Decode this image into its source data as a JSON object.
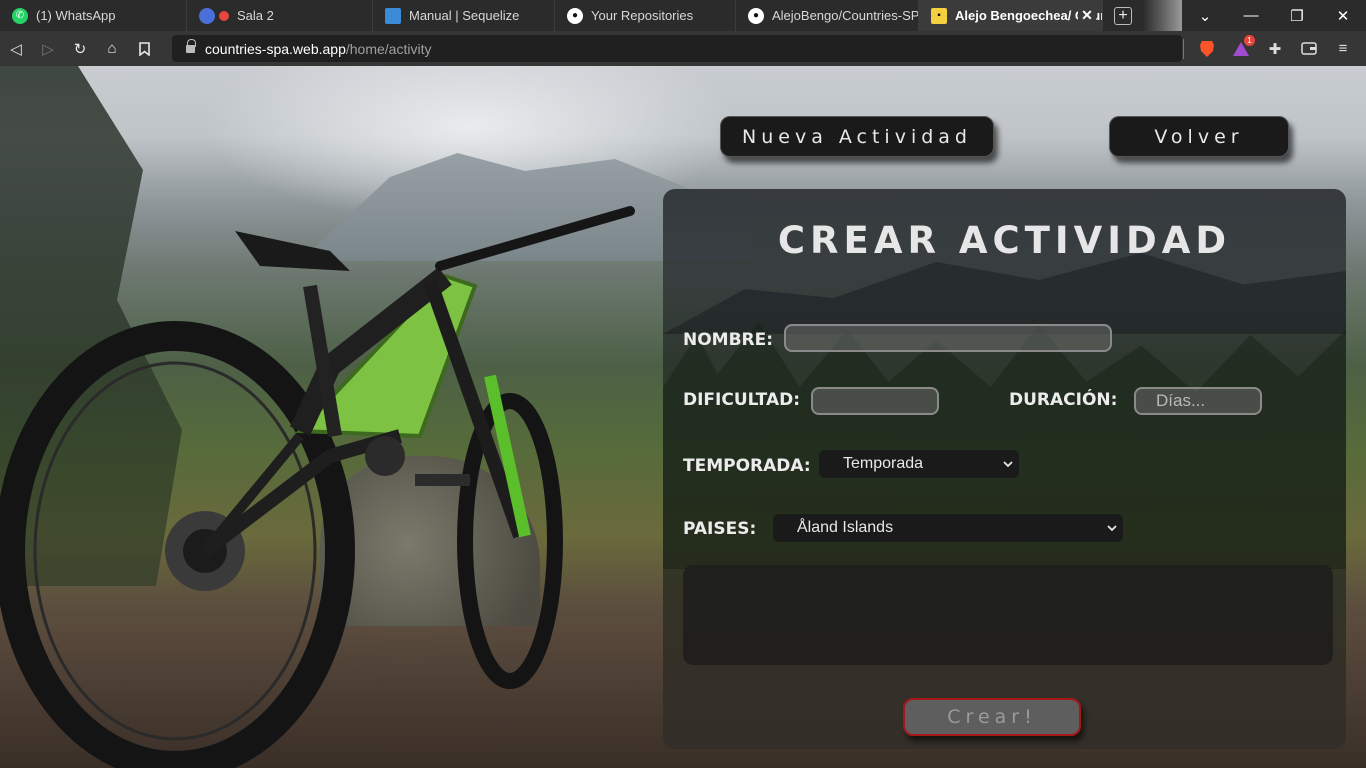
{
  "browser": {
    "tabs": [
      {
        "title": "(1) WhatsApp",
        "icon": "whatsapp-icon",
        "color": "#25d366"
      },
      {
        "title": "Sala 2",
        "icon": "record-icon",
        "color": "#e8453c"
      },
      {
        "title": "Manual | Sequelize",
        "icon": "sequelize-icon",
        "color": "#3b8bd6"
      },
      {
        "title": "Your Repositories",
        "icon": "github-icon",
        "color": "#ffffff"
      },
      {
        "title": "AlejoBengo/Countries-SPA",
        "icon": "github-icon",
        "color": "#ffffff"
      },
      {
        "title": "Alejo Bengoechea/ Countries",
        "icon": "app-icon",
        "color": "#f4d03f"
      }
    ],
    "url_host": "countries-spa.web.app",
    "url_path": "/home/activity",
    "brave_badge": "1"
  },
  "header": {
    "nueva_actividad": "Nueva Actividad",
    "volver": "Volver"
  },
  "form": {
    "title": "CREAR ACTIVIDAD",
    "nombre_label": "NOMBRE:",
    "nombre_value": "",
    "dificultad_label": "DIFICULTAD:",
    "dificultad_value": "",
    "duracion_label": "DURACIÓN:",
    "duracion_placeholder": "Días...",
    "temporada_label": "TEMPORADA:",
    "temporada_selected": "Temporada",
    "paises_label": "PAISES:",
    "paises_selected": "Åland Islands",
    "submit": "Crear!"
  },
  "colors": {
    "accent_border": "#a61818",
    "button_bg": "#1a1a1a"
  }
}
